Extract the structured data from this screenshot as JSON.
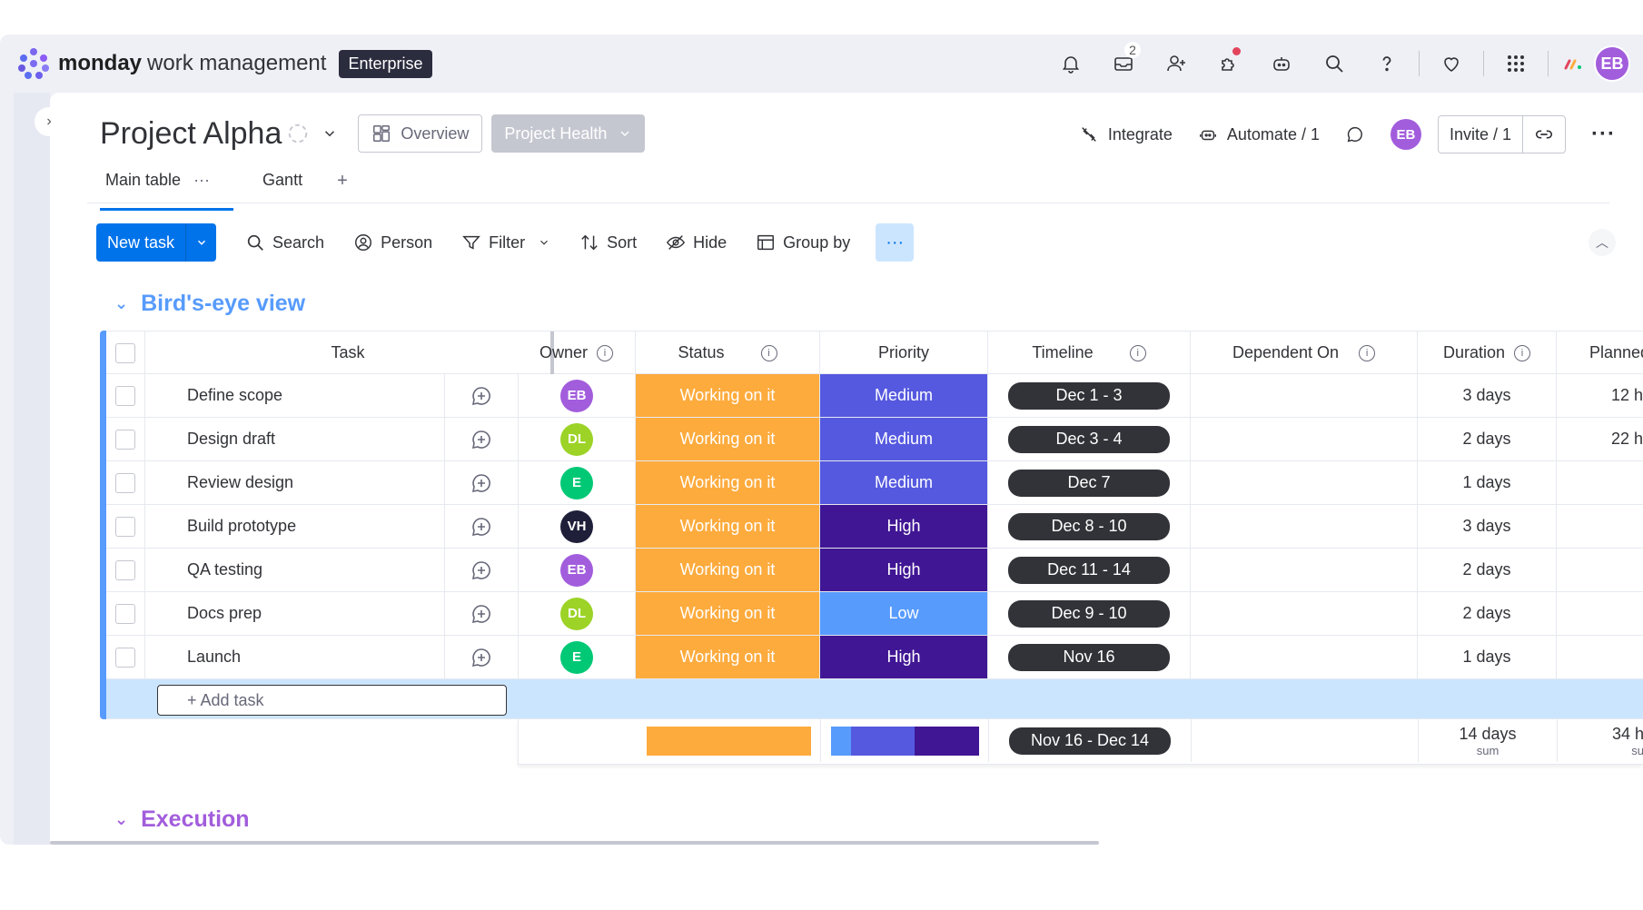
{
  "app": {
    "brand_bold": "monday",
    "brand_rest": "work management",
    "plan": "Enterprise",
    "inbox_badge": "2",
    "user_initials": "EB"
  },
  "board": {
    "title": "Project Alpha",
    "overview_label": "Overview",
    "health_label": "Project Health",
    "integrate_label": "Integrate",
    "automate_label": "Automate / 1",
    "invite_label": "Invite / 1",
    "tabs": [
      {
        "label": "Main table",
        "active": true
      },
      {
        "label": "Gantt",
        "active": false
      }
    ],
    "add_tab": "+"
  },
  "toolbar": {
    "new_task": "New task",
    "search": "Search",
    "person": "Person",
    "filter": "Filter",
    "sort": "Sort",
    "hide": "Hide",
    "group_by": "Group by",
    "more": "···"
  },
  "groups": [
    {
      "title": "Bird's-eye view",
      "color": "#579bfc"
    },
    {
      "title": "Execution",
      "color": "#a25ddc"
    }
  ],
  "columns": {
    "task": "Task",
    "owner": "Owner",
    "status": "Status",
    "priority": "Priority",
    "timeline": "Timeline",
    "dependent_on": "Dependent On",
    "duration": "Duration",
    "planned": "Planned"
  },
  "colors": {
    "medium": "#5559df",
    "high": "#401694",
    "low": "#579bfc",
    "working": "#fdab3d"
  },
  "rows": [
    {
      "task": "Define scope",
      "owner": "EB",
      "owner_color": "#a25ddc",
      "status": "Working on it",
      "priority": "Medium",
      "timeline": "Dec 1 - 3",
      "duration": "3 days",
      "planned": "12 h"
    },
    {
      "task": "Design draft",
      "owner": "DL",
      "owner_color": "#9cd326",
      "status": "Working on it",
      "priority": "Medium",
      "timeline": "Dec 3 - 4",
      "duration": "2 days",
      "planned": "22 h"
    },
    {
      "task": "Review design",
      "owner": "E",
      "owner_color": "#00c875",
      "status": "Working on it",
      "priority": "Medium",
      "timeline": "Dec 7",
      "duration": "1 days",
      "planned": ""
    },
    {
      "task": "Build prototype",
      "owner": "VH",
      "owner_color": "#1f1f3a",
      "status": "Working on it",
      "priority": "High",
      "timeline": "Dec 8 - 10",
      "duration": "3 days",
      "planned": ""
    },
    {
      "task": "QA testing",
      "owner": "EB",
      "owner_color": "#a25ddc",
      "status": "Working on it",
      "priority": "High",
      "timeline": "Dec 11 - 14",
      "duration": "2 days",
      "planned": ""
    },
    {
      "task": "Docs prep",
      "owner": "DL",
      "owner_color": "#9cd326",
      "status": "Working on it",
      "priority": "Low",
      "timeline": "Dec 9 - 10",
      "duration": "2 days",
      "planned": ""
    },
    {
      "task": "Launch",
      "owner": "E",
      "owner_color": "#00c875",
      "status": "Working on it",
      "priority": "High",
      "timeline": "Nov 16",
      "duration": "1 days",
      "planned": ""
    }
  ],
  "add_task": "+ Add task",
  "summary": {
    "timeline": "Nov 16 - Dec 14",
    "duration": "14 days",
    "duration_sub": "sum",
    "planned": "34 h",
    "planned_sub": "su",
    "priority_shares": [
      0.14,
      0.43,
      0.43
    ]
  }
}
